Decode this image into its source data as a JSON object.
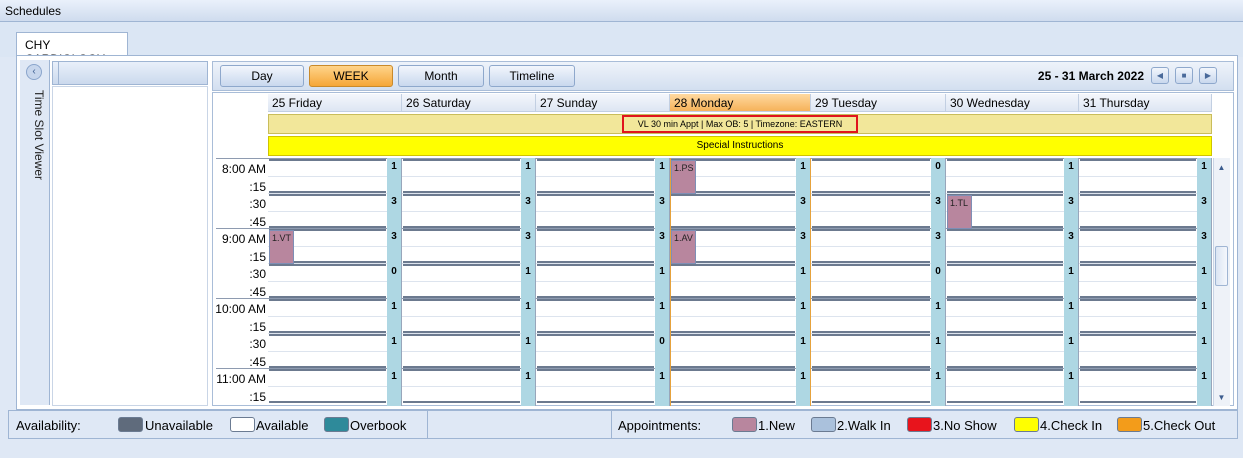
{
  "window": {
    "title": "Schedules"
  },
  "tab": {
    "label": "CHY CARDIOLOGY"
  },
  "time_slot_viewer": {
    "label": "Time Slot Viewer",
    "collapse_icon": "chevron-left-icon"
  },
  "toolbar": {
    "views": [
      {
        "label": "Day",
        "active": false
      },
      {
        "label": "WEEK",
        "active": true
      },
      {
        "label": "Month",
        "active": false
      },
      {
        "label": "Timeline",
        "active": false
      }
    ],
    "date_range": "25 - 31 March 2022",
    "nav_icons": [
      "arrow-left-icon",
      "calendar-icon",
      "arrow-right-icon"
    ]
  },
  "days": [
    {
      "label": "25 Friday",
      "today": false
    },
    {
      "label": "26 Saturday",
      "today": false
    },
    {
      "label": "27 Sunday",
      "today": false
    },
    {
      "label": "28 Monday",
      "today": true
    },
    {
      "label": "29 Tuesday",
      "today": false
    },
    {
      "label": "30 Wednesday",
      "today": false
    },
    {
      "label": "31 Thursday",
      "today": false
    }
  ],
  "info_bar": "VL 30 min Appt | Max OB: 5 | Timezone: EASTERN",
  "special_instructions": "Special Instructions",
  "time_labels": [
    "8:00 AM",
    ":15",
    ":30",
    ":45",
    "9:00 AM",
    ":15",
    ":30",
    ":45",
    "10:00 AM",
    ":15",
    ":30",
    ":45",
    "11:00 AM",
    ":15"
  ],
  "capacity": [
    [
      "1",
      "1",
      "1",
      "1",
      "0",
      "1",
      "1"
    ],
    [
      "3",
      "3",
      "3",
      "3",
      "3",
      "3",
      "3"
    ],
    [
      "3",
      "3",
      "3",
      "3",
      "3",
      "3",
      "3"
    ],
    [
      "0",
      "1",
      "1",
      "1",
      "0",
      "1",
      "1"
    ],
    [
      "1",
      "1",
      "1",
      "1",
      "1",
      "1",
      "1"
    ],
    [
      "1",
      "1",
      "0",
      "1",
      "1",
      "1",
      "1"
    ],
    [
      "1",
      "1",
      "1",
      "1",
      "1",
      "1",
      "1"
    ]
  ],
  "appointments": [
    {
      "label": "1.PS",
      "day": 3,
      "slot": 0
    },
    {
      "label": "1.TL",
      "day": 5,
      "slot": 2
    },
    {
      "label": "1.VT",
      "day": 0,
      "slot": 4
    },
    {
      "label": "1.AV",
      "day": 3,
      "slot": 4
    }
  ],
  "legend": {
    "availability_label": "Availability:",
    "availability": [
      {
        "label": "Unavailable",
        "color": "#5f6b7c"
      },
      {
        "label": "Available",
        "color": "#ffffff"
      },
      {
        "label": "Overbook",
        "color": "#2e8a9a"
      }
    ],
    "appointments_label": "Appointments:",
    "appointments": [
      {
        "label": "1.New",
        "color": "#b8869e"
      },
      {
        "label": "2.Walk In",
        "color": "#aac1dc"
      },
      {
        "label": "3.No Show",
        "color": "#e8141c"
      },
      {
        "label": "4.Check In",
        "color": "#ffff00"
      },
      {
        "label": "5.Check Out",
        "color": "#f39c1a"
      }
    ]
  }
}
